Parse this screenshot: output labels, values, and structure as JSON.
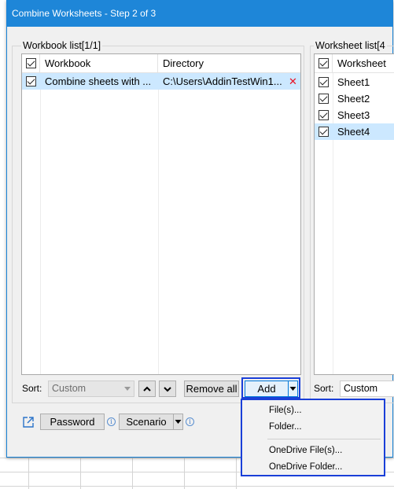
{
  "window": {
    "title": "Combine Worksheets - Step 2 of 3"
  },
  "workbook_list": {
    "label": "Workbook list[1/1]",
    "columns": {
      "workbook": "Workbook",
      "directory": "Directory"
    },
    "rows": [
      {
        "checked": true,
        "workbook": "Combine sheets with ...",
        "directory": "C:\\Users\\AddinTestWin1...",
        "remove_icon": "x-icon"
      }
    ]
  },
  "worksheet_list": {
    "label": "Worksheet list[4",
    "columns": {
      "worksheet": "Worksheet"
    },
    "rows": [
      {
        "checked": true,
        "name": "Sheet1"
      },
      {
        "checked": true,
        "name": "Sheet2"
      },
      {
        "checked": true,
        "name": "Sheet3"
      },
      {
        "checked": true,
        "name": "Sheet4"
      }
    ]
  },
  "workbook_controls": {
    "sort_label": "Sort:",
    "sort_value": "Custom",
    "move_up_icon": "chevron-up-icon",
    "move_down_icon": "chevron-down-icon",
    "remove_all_label": "Remove all",
    "add_label": "Add"
  },
  "worksheet_controls": {
    "sort_label": "Sort:",
    "sort_value": "Custom"
  },
  "add_menu": {
    "items": [
      "File(s)...",
      "Folder...",
      "OneDrive File(s)...",
      "OneDrive Folder..."
    ]
  },
  "bottom": {
    "share_icon": "external-link-icon",
    "password_label": "Password",
    "scenario_label": "Scenario",
    "info_icon": "info-icon"
  },
  "colors": {
    "titlebar": "#1e86d8",
    "selection": "#cce8ff",
    "highlight_outline": "#1a3fd8",
    "remove_x": "#e81123"
  }
}
